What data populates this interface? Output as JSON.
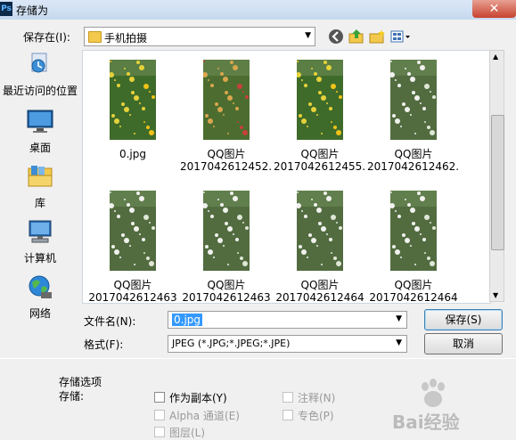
{
  "window": {
    "title": "存储为",
    "app_badge": "Ps",
    "close_glyph": "✕"
  },
  "location": {
    "label": "保存在(I):",
    "folder": "手机拍摄"
  },
  "places": [
    {
      "name": "recent",
      "label": "最近访问的位置"
    },
    {
      "name": "desktop",
      "label": "桌面"
    },
    {
      "name": "library",
      "label": "库"
    },
    {
      "name": "computer",
      "label": "计算机"
    },
    {
      "name": "network",
      "label": "网络"
    }
  ],
  "files": [
    {
      "line1": "0.jpg",
      "line2": "",
      "palette": "yellow"
    },
    {
      "line1": "QQ图片",
      "line2": "2017042612452...",
      "palette": "red"
    },
    {
      "line1": "QQ图片",
      "line2": "2017042612455...",
      "palette": "yellow"
    },
    {
      "line1": "QQ图片",
      "line2": "2017042612462...",
      "palette": "white"
    },
    {
      "line1": "QQ图片",
      "line2": "2017042612463",
      "palette": "white"
    },
    {
      "line1": "QQ图片",
      "line2": "2017042612463",
      "palette": "white"
    },
    {
      "line1": "QQ图片",
      "line2": "2017042612464",
      "palette": "white"
    },
    {
      "line1": "QQ图片",
      "line2": "2017042612464",
      "palette": "white"
    }
  ],
  "filename": {
    "label": "文件名(N):",
    "value": "0.jpg"
  },
  "format": {
    "label": "格式(F):",
    "value": "JPEG (*.JPG;*.JPEG;*.JPE)"
  },
  "buttons": {
    "save": "保存(S)",
    "cancel": "取消"
  },
  "options": {
    "section_title": "存储选项",
    "store_label": "存储:",
    "checkboxes": [
      {
        "label": "作为副本(Y)",
        "enabled": true,
        "checked": false
      },
      {
        "label": "注释(N)",
        "enabled": false,
        "checked": false
      },
      {
        "label": "Alpha 通道(E)",
        "enabled": false,
        "checked": false
      },
      {
        "label": "专色(P)",
        "enabled": false,
        "checked": false
      },
      {
        "label": "图层(L)",
        "enabled": false,
        "checked": false
      }
    ]
  },
  "watermark": "Bai经验"
}
